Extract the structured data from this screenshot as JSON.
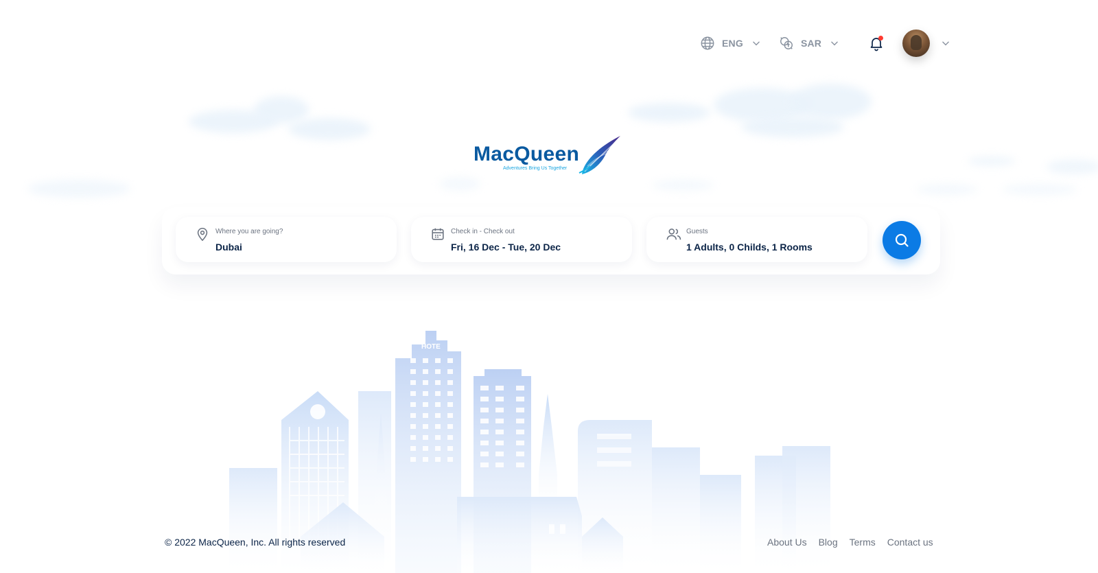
{
  "header": {
    "language": {
      "label": "ENG",
      "icon": "globe-icon"
    },
    "currency": {
      "label": "SAR",
      "icon": "currency-icon"
    },
    "notifications": {
      "icon": "bell-icon",
      "has_unread": true
    },
    "user": {
      "icon": "avatar"
    }
  },
  "logo": {
    "name": "MacQueen",
    "tagline": "Adventures Bring Us Together"
  },
  "search": {
    "destination": {
      "label": "Where you are going?",
      "value": "Dubai",
      "icon": "location-pin-icon"
    },
    "dates": {
      "label": "Check in - Check out",
      "value": "Fri, 16 Dec - Tue, 20 Dec",
      "icon": "calendar-icon"
    },
    "guests": {
      "label": "Guests",
      "value": "1 Adults, 0 Childs, 1 Rooms",
      "icon": "users-icon"
    },
    "submit_icon": "search-icon"
  },
  "skyline": {
    "hotel_sign": "HOTE"
  },
  "footer": {
    "copyright": "© 2022 MacQueen, Inc. All rights reserved",
    "links": [
      "About Us",
      "Blog",
      "Terms",
      "Contact us"
    ]
  },
  "colors": {
    "primary": "#0b7be5",
    "brand": "#0a5aa0",
    "text_dark": "#0b2447",
    "text_muted": "#6b7380",
    "notification_dot": "#ff3b30"
  }
}
